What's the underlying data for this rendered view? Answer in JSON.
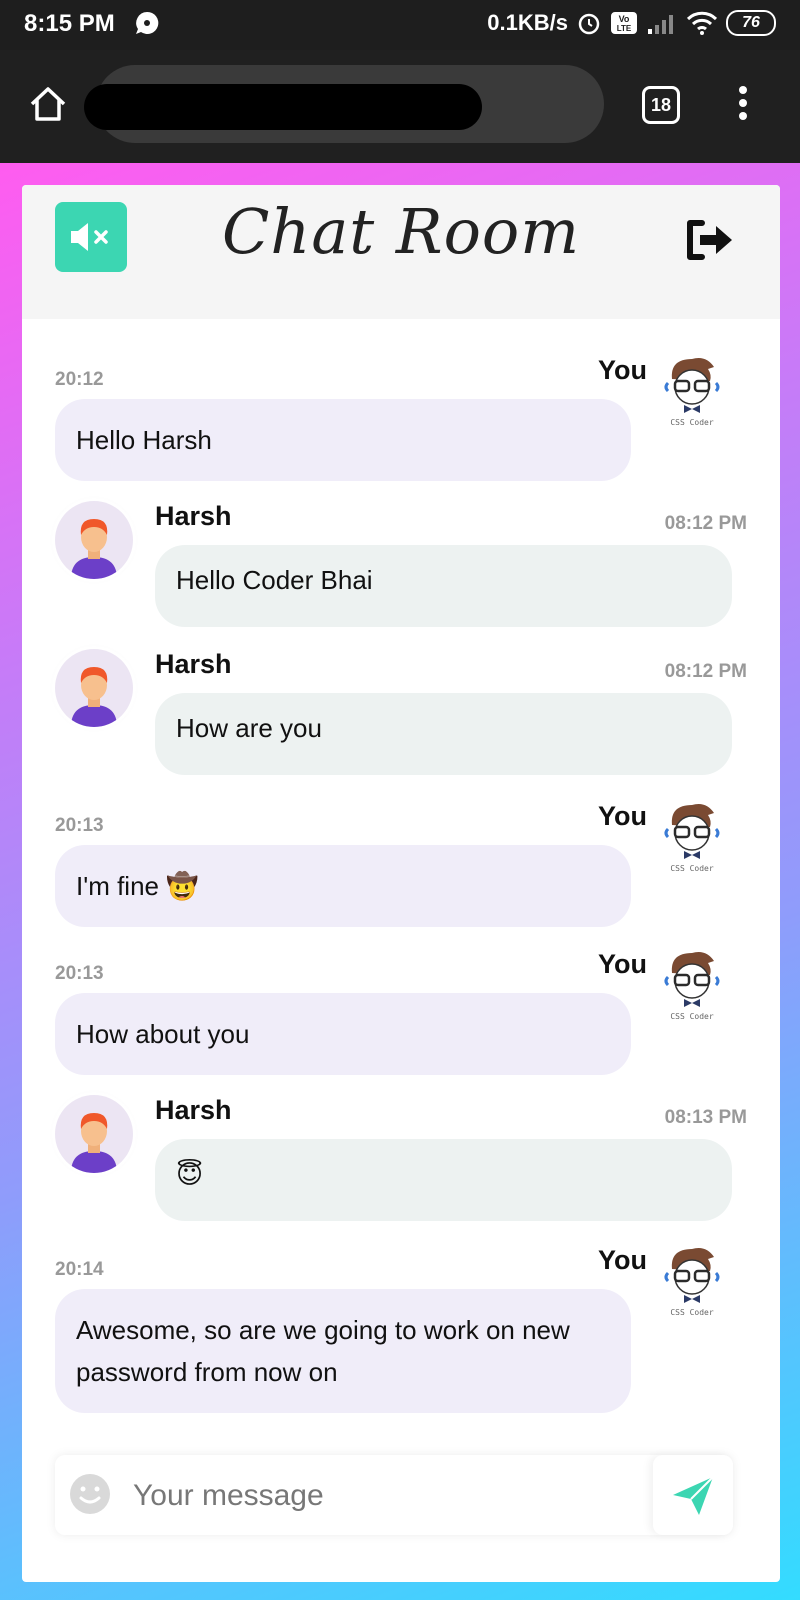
{
  "status_bar": {
    "time": "8:15 PM",
    "speed": "0.1KB/s",
    "battery": "76"
  },
  "browser": {
    "tab_count": "18"
  },
  "colors": {
    "accent": "#3cd6b2",
    "outgoing_bubble": "#f0edf9",
    "incoming_bubble": "#edf2f1"
  },
  "chat": {
    "title": "Chat Room",
    "messages": [
      {
        "direction": "out",
        "sender": "You",
        "time": "20:12",
        "text": "Hello Harsh"
      },
      {
        "direction": "in",
        "sender": "Harsh",
        "time": "08:12 PM",
        "text": "Hello Coder Bhai"
      },
      {
        "direction": "in",
        "sender": "Harsh",
        "time": "08:12 PM",
        "text": "How are you"
      },
      {
        "direction": "out",
        "sender": "You",
        "time": "20:13",
        "text": "I'm fine 🤠"
      },
      {
        "direction": "out",
        "sender": "You",
        "time": "20:13",
        "text": "How about you"
      },
      {
        "direction": "in",
        "sender": "Harsh",
        "time": "08:13 PM",
        "text": "😇"
      },
      {
        "direction": "out",
        "sender": "You",
        "time": "20:14",
        "text": "Awesome, so are we going to work on new password from now on"
      }
    ],
    "avatar_caption": "CSS Coder"
  },
  "composer": {
    "placeholder": "Your message"
  }
}
